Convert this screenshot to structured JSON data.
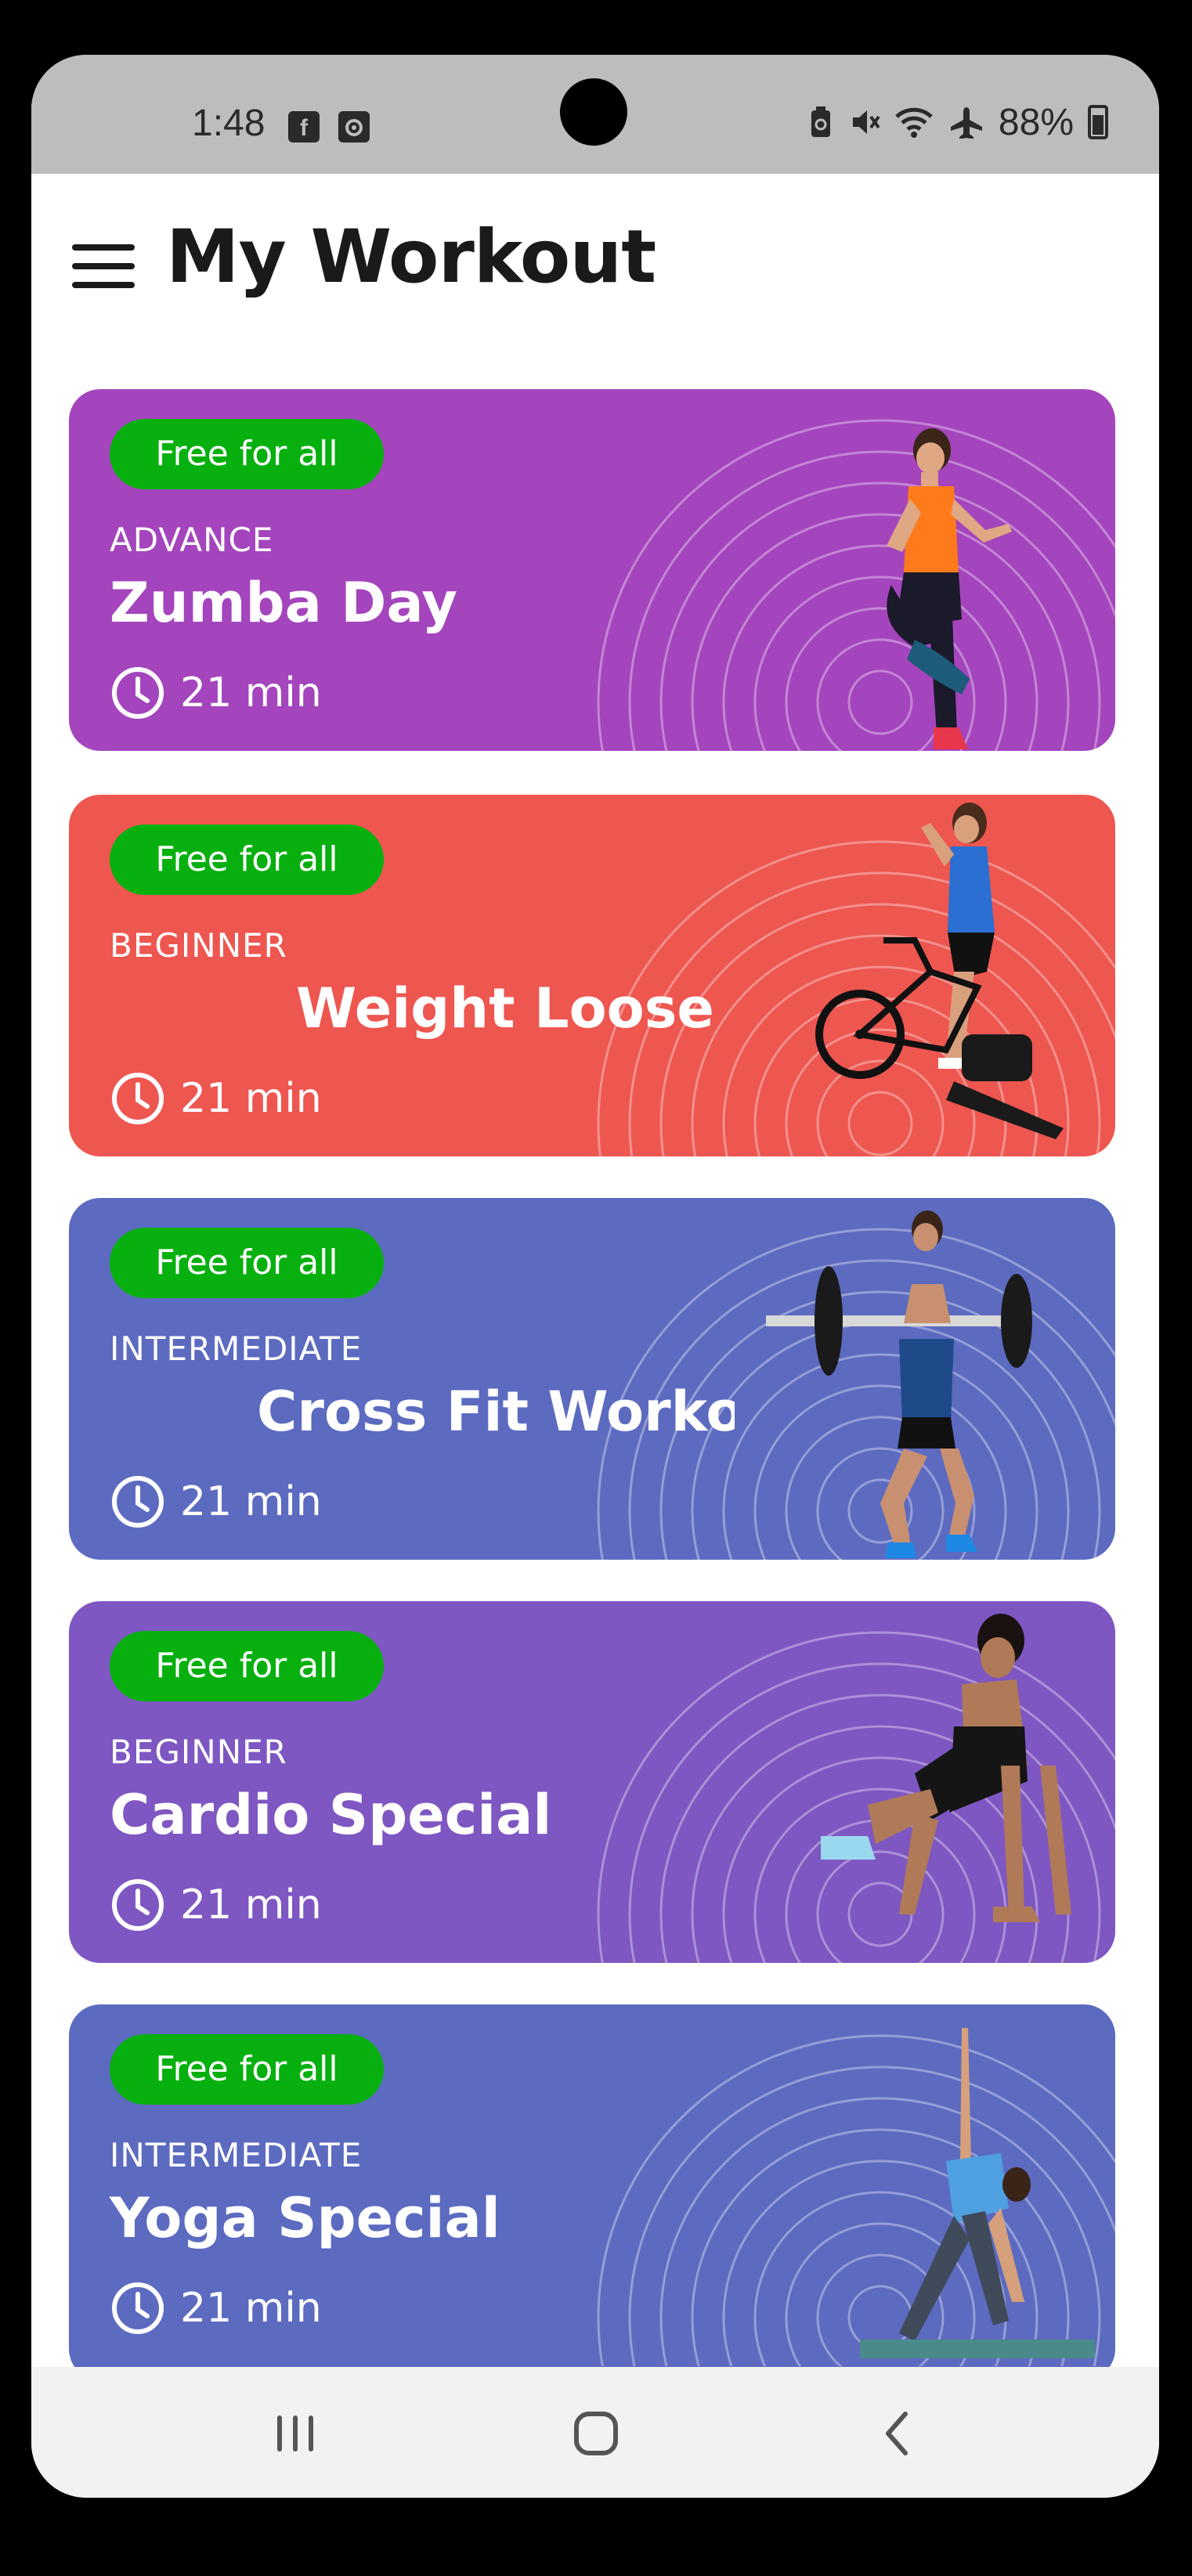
{
  "status_bar": {
    "time": "1:48",
    "left_icons": [
      "facebook-icon",
      "screen-record-icon"
    ],
    "right_icons": [
      "battery-saver-icon",
      "mute-icon",
      "wifi-icon",
      "airplane-icon"
    ],
    "battery": "88%"
  },
  "header": {
    "title": "My Workout",
    "menu_icon": "hamburger-menu-icon"
  },
  "workouts": [
    {
      "badge": "Free for all",
      "level": "ADVANCE",
      "name": "Zumba Day",
      "duration": "21 min",
      "color": "#a445bd"
    },
    {
      "badge": "Free for all",
      "level": "BEGINNER",
      "name": "Weight Loose I",
      "duration": "21 min",
      "color": "#ee5650"
    },
    {
      "badge": "Free for all",
      "level": "INTERMEDIATE",
      "name": "Cross Fit Worko",
      "duration": "21 min",
      "color": "#5c6bc0"
    },
    {
      "badge": "Free for all",
      "level": "BEGINNER",
      "name": "Cardio Special",
      "duration": "21 min",
      "color": "#7e57c2"
    },
    {
      "badge": "Free for all",
      "level": "INTERMEDIATE",
      "name": "Yoga Special",
      "duration": "21 min",
      "color": "#5c6bc0"
    }
  ],
  "colors": {
    "badge": "#07b00f",
    "status_bar": "#bdbdbd",
    "nav_bar": "#f2f2f2"
  },
  "nav_bar": {
    "icons": [
      "recent-apps-icon",
      "home-icon",
      "back-icon"
    ]
  }
}
